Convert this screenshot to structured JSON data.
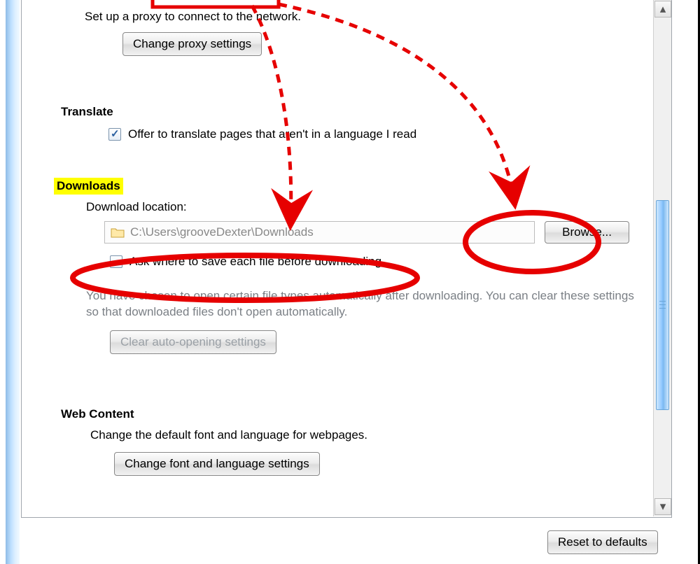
{
  "network": {
    "description": "Set up a proxy to connect to the network.",
    "change_proxy_button": "Change proxy settings"
  },
  "translate": {
    "title": "Translate",
    "offer_label": "Offer to translate pages that aren't in a language I read",
    "offer_checked": true
  },
  "downloads": {
    "title": "Downloads",
    "location_label": "Download location:",
    "path": "C:\\Users\\grooveDexter\\Downloads",
    "browse_button": "Browse...",
    "ask_label": "Ask where to save each file before downloading",
    "ask_checked": false,
    "help_text": "You have chosen to open certain file types automatically after downloading. You can clear these settings so that downloaded files don't open automatically.",
    "clear_button": "Clear auto-opening settings"
  },
  "web_content": {
    "title": "Web Content",
    "description": "Change the default font and language for webpages.",
    "change_button": "Change font and language settings"
  },
  "footer": {
    "reset_button": "Reset to defaults"
  },
  "scrollbar": {
    "up_glyph": "▴",
    "down_glyph": "▾"
  }
}
